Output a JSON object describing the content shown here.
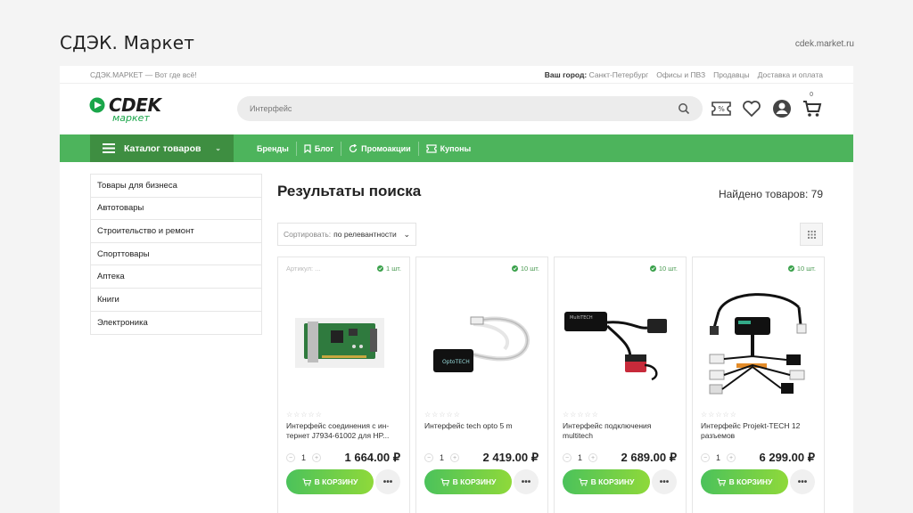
{
  "slide": {
    "title": "СДЭК. Маркет",
    "url": "cdek.market.ru"
  },
  "topbar": {
    "tagline": "СДЭК.МАРКЕТ — Вот где всё!",
    "city_label": "Ваш город:",
    "city": "Санкт-Петербург",
    "links": [
      "Офисы и ПВЗ",
      "Продавцы",
      "Доставка и оплата"
    ]
  },
  "header": {
    "logo_main": "СDEK",
    "logo_sub": "маркет",
    "search_value": "Интерфейс",
    "cart_count": "0",
    "brand_color": "#4db45c"
  },
  "nav": {
    "catalog_label": "Каталог товаров",
    "links": [
      "Бренды",
      "Блог",
      "Промоакции",
      "Купоны"
    ]
  },
  "sidebar": {
    "categories": [
      "Товары для бизнеса",
      "Автотовары",
      "Строительство и ремонт",
      "Спорттовары",
      "Аптека",
      "Книги",
      "Электроника"
    ]
  },
  "main": {
    "title": "Результаты поиска",
    "found": "Найдено товаров: 79",
    "sort_label": "Сортировать:",
    "sort_value": "по релевантности"
  },
  "products": [
    {
      "sku": "Артикул: ...",
      "stock": "1 шт.",
      "name": "Интерфейс соединения с ин-тернет J7934-61002 для HP...",
      "qty": "1",
      "price": "1 664.00 ₽",
      "cart_label": "В КОРЗИНУ",
      "image": "network-card"
    },
    {
      "sku": "",
      "stock": "10 шт.",
      "name": "Интерфейс tech opto 5 m",
      "qty": "1",
      "price": "2 419.00 ₽",
      "cart_label": "В КОРЗИНУ",
      "image": "opto-cable"
    },
    {
      "sku": "",
      "stock": "10 шт.",
      "name": "Интерфейс подключения multitech",
      "qty": "1",
      "price": "2 689.00 ₽",
      "cart_label": "В КОРЗИНУ",
      "image": "multitech-cable"
    },
    {
      "sku": "",
      "stock": "10 шт.",
      "name": "Интерфейс Projekt-TECH 12 разъемов",
      "qty": "1",
      "price": "6 299.00 ₽",
      "cart_label": "В КОРЗИНУ",
      "image": "connector-harness"
    }
  ]
}
